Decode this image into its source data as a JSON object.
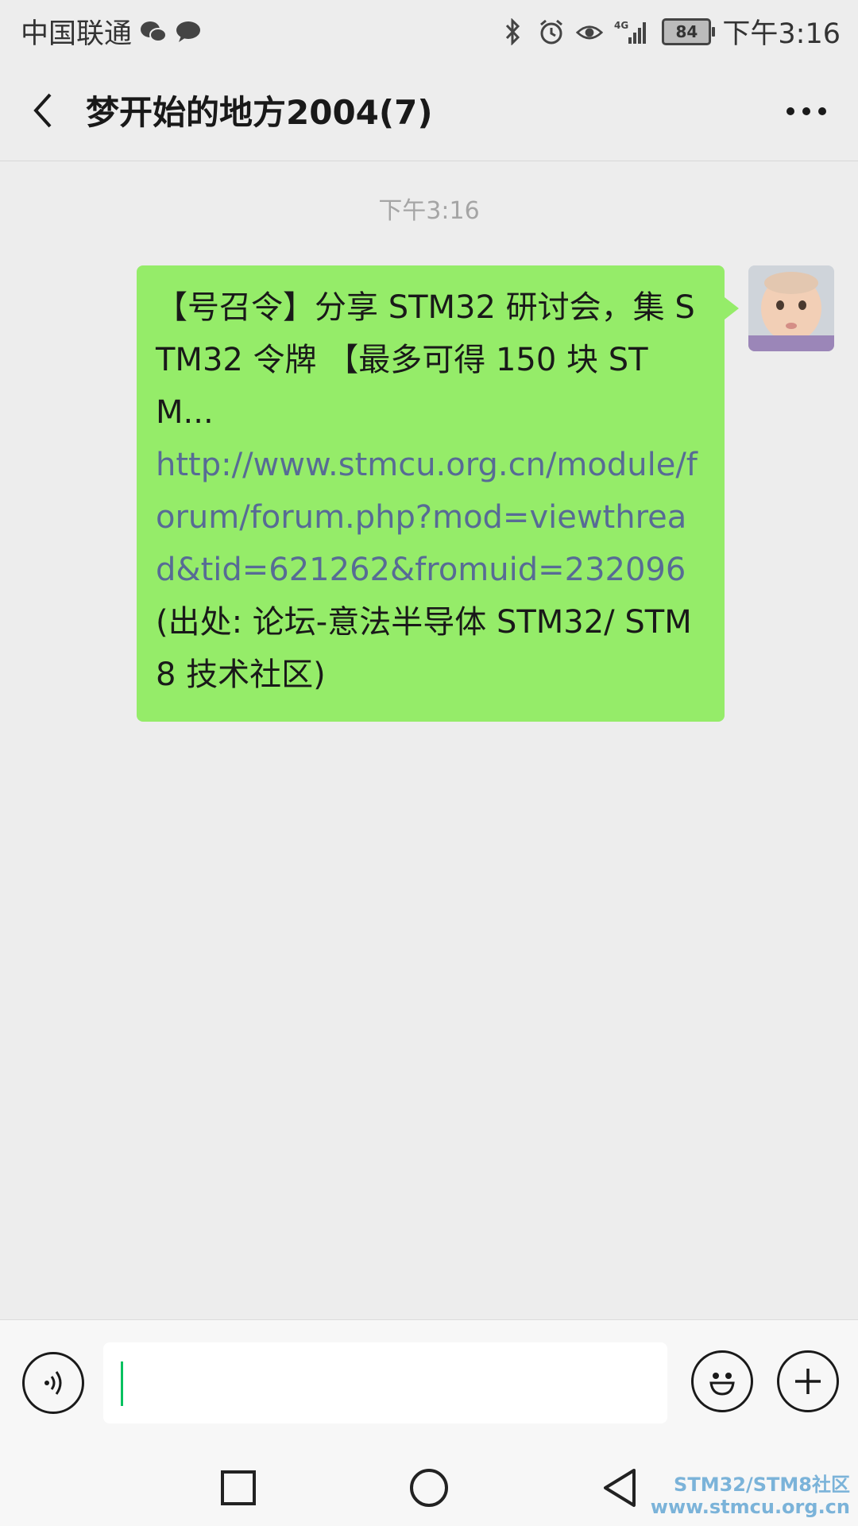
{
  "status_bar": {
    "carrier": "中国联通",
    "network": "4G",
    "battery": "84",
    "time": "下午3:16"
  },
  "header": {
    "title": "梦开始的地方2004(7)"
  },
  "chat": {
    "timestamp": "下午3:16",
    "message": {
      "text_intro": "【号召令】分享 STM32 研讨会，集 STM32 令牌 【最多可得 150 块 STM...",
      "link": "http://www.stmcu.org.cn/module/forum/forum.php?mod=viewthread&tid=621262&fromuid=232096",
      "source": "(出处: 论坛-意法半导体 STM32/ STM8 技术社区)"
    }
  },
  "input_bar": {
    "value": ""
  },
  "watermark": {
    "line1": "STM32/STM8社区",
    "line2": "www.stmcu.org.cn"
  },
  "colors": {
    "bubble": "#95ec69",
    "link": "#576b95",
    "caret": "#07c160"
  }
}
